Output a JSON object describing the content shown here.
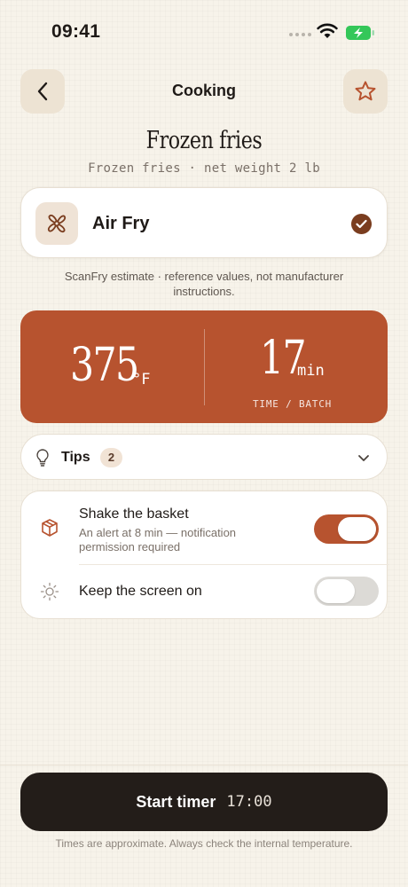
{
  "status_bar": {
    "time": "09:41"
  },
  "header": {
    "title": "Cooking"
  },
  "food": {
    "title": "Frozen fries",
    "subtitle": "Frozen fries · net weight 2 lb"
  },
  "mode": {
    "label": "Air Fry",
    "selected": true
  },
  "estimate_note": "ScanFry estimate · reference values, not manufacturer instructions.",
  "settings": {
    "temperature": "375",
    "temperature_unit": "°F",
    "time": "17",
    "time_unit": "min",
    "time_caption": "TIME / BATCH"
  },
  "tips": {
    "label": "Tips",
    "count": "2"
  },
  "options": [
    {
      "title": "Shake the basket",
      "subtitle": "An alert at 8 min — notification permission required",
      "enabled": true
    },
    {
      "title": "Keep the screen on",
      "enabled": false
    }
  ],
  "start_button": {
    "label": "Start timer",
    "time": "17:00"
  },
  "footnote": "Times are approximate. Always check the internal temperature.",
  "colors": {
    "accent": "#b7532f",
    "background": "#f7f3ea",
    "dark_button": "#231d19",
    "check": "#7a3d1f",
    "battery": "#34c759"
  },
  "icons": {
    "back": "chevron-left-icon",
    "favorite": "star-icon",
    "mode": "fan-icon",
    "check": "checkmark-icon",
    "tips": "lightbulb-icon",
    "expand": "chevron-down-icon",
    "shake": "box-icon",
    "screen": "sun-icon"
  }
}
